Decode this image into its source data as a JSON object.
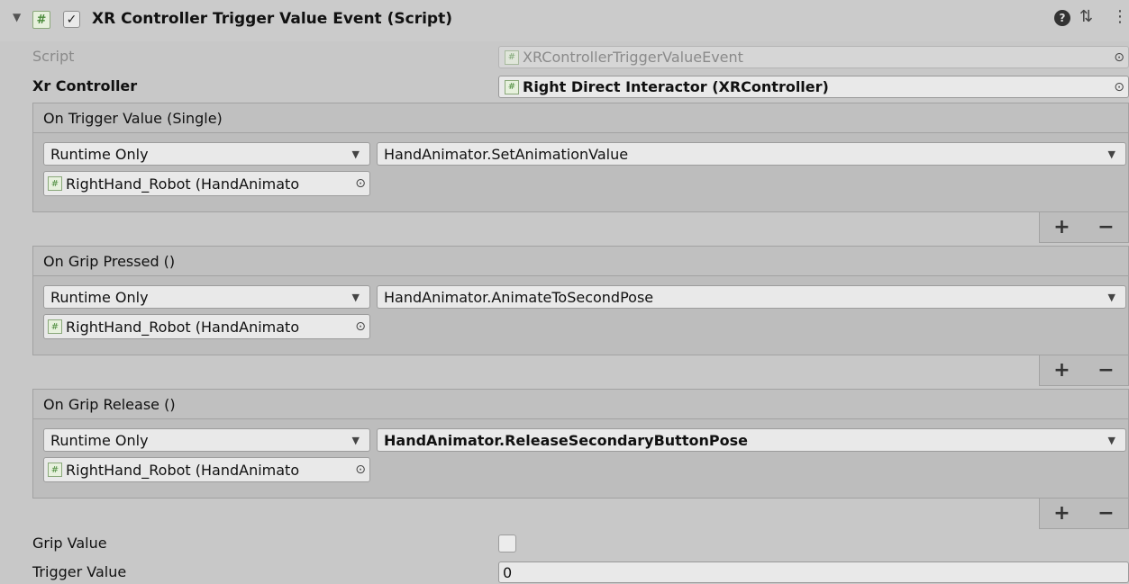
{
  "header": {
    "foldout_icon": "triangle-down-icon",
    "script_icon": "csharp-script-icon",
    "enabled_checkmark": "✓",
    "title": "XR Controller Trigger Value Event (Script)",
    "help_icon": "help-icon",
    "presets_icon": "presets-icon",
    "menu_icon": "kebab-menu-icon"
  },
  "fields": {
    "script_label": "Script",
    "script_value": "XRControllerTriggerValueEvent",
    "xr_controller_label": "Xr Controller",
    "xr_controller_value": "Right Direct Interactor (XRController)",
    "grip_value_label": "Grip Value",
    "grip_value_checked": false,
    "trigger_value_label": "Trigger Value",
    "trigger_value_value": "0"
  },
  "events": [
    {
      "title": "On Trigger Value (Single)",
      "call_state": "Runtime Only",
      "function": "HandAnimator.SetAnimationValue",
      "target": "RightHand_Robot (HandAnimato",
      "function_bold": false
    },
    {
      "title": "On Grip Pressed ()",
      "call_state": "Runtime Only",
      "function": "HandAnimator.AnimateToSecondPose",
      "target": "RightHand_Robot (HandAnimato",
      "function_bold": false
    },
    {
      "title": "On Grip Release ()",
      "call_state": "Runtime Only",
      "function": "HandAnimator.ReleaseSecondaryButtonPose",
      "target": "RightHand_Robot (HandAnimato",
      "function_bold": true
    }
  ],
  "list_buttons": {
    "add": "+",
    "remove": "−"
  },
  "colors": {
    "panel_bg": "#c8c8c8",
    "field_bg": "#e9e9e9",
    "script_icon_green": "#4a8a3a"
  }
}
